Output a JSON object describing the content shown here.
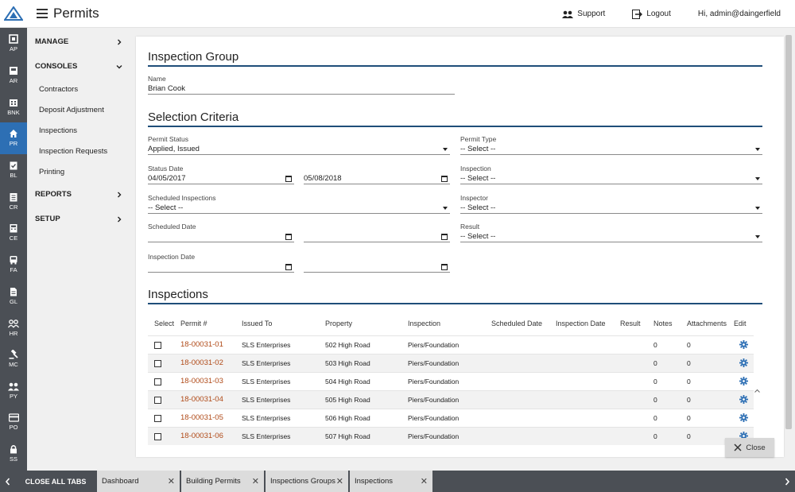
{
  "app": {
    "title": "Permits"
  },
  "header": {
    "support_label": "Support",
    "logout_label": "Logout",
    "greeting": "Hi, admin@daingerfield"
  },
  "rail": [
    {
      "code": "AP",
      "icon": "ap-icon"
    },
    {
      "code": "AR",
      "icon": "ar-icon"
    },
    {
      "code": "BNK",
      "icon": "bank-icon"
    },
    {
      "code": "PR",
      "icon": "home-icon",
      "active": true
    },
    {
      "code": "BL",
      "icon": "clipboard-check-icon"
    },
    {
      "code": "CR",
      "icon": "receipt-icon"
    },
    {
      "code": "CE",
      "icon": "calculator-icon"
    },
    {
      "code": "FA",
      "icon": "bus-icon"
    },
    {
      "code": "GL",
      "icon": "document-icon"
    },
    {
      "code": "HR",
      "icon": "people-icon"
    },
    {
      "code": "MC",
      "icon": "gavel-icon"
    },
    {
      "code": "PY",
      "icon": "group-icon"
    },
    {
      "code": "PO",
      "icon": "credit-card-icon"
    },
    {
      "code": "SS",
      "icon": "lock-icon"
    }
  ],
  "sidenav": {
    "manage": "MANAGE",
    "consoles": "CONSOLES",
    "console_items": [
      "Contractors",
      "Deposit Adjustment",
      "Inspections",
      "Inspection Requests",
      "Printing"
    ],
    "reports": "REPORTS",
    "setup": "SETUP"
  },
  "group": {
    "title": "Inspection Group",
    "name_label": "Name",
    "name_value": "Brian Cook"
  },
  "criteria": {
    "title": "Selection Criteria",
    "permit_status_label": "Permit Status",
    "permit_status_value": "Applied, Issued",
    "permit_type_label": "Permit Type",
    "permit_type_value": "-- Select --",
    "status_date_label": "Status Date",
    "status_date_from": "04/05/2017",
    "status_date_to": "05/08/2018",
    "inspection_label": "Inspection",
    "inspection_value": "-- Select --",
    "scheduled_insp_label": "Scheduled Inspections",
    "scheduled_insp_value": "-- Select --",
    "inspector_label": "Inspector",
    "inspector_value": "-- Select --",
    "scheduled_date_label": "Scheduled Date",
    "result_label": "Result",
    "result_value": "-- Select --",
    "inspection_date_label": "Inspection Date"
  },
  "inspections": {
    "title": "Inspections",
    "columns": [
      "Select",
      "Permit #",
      "Issued To",
      "Property",
      "Inspection",
      "Scheduled Date",
      "Inspection Date",
      "Result",
      "Notes",
      "Attachments",
      "Edit"
    ],
    "rows": [
      {
        "permit": "18-00031-01",
        "issued_to": "SLS Enterprises",
        "property": "502 High Road",
        "inspection": "Piers/Foundation",
        "scheduled": "",
        "inspected": "",
        "result": "",
        "notes": "0",
        "attachments": "0"
      },
      {
        "permit": "18-00031-02",
        "issued_to": "SLS Enterprises",
        "property": "503 High Road",
        "inspection": "Piers/Foundation",
        "scheduled": "",
        "inspected": "",
        "result": "",
        "notes": "0",
        "attachments": "0"
      },
      {
        "permit": "18-00031-03",
        "issued_to": "SLS Enterprises",
        "property": "504 High Road",
        "inspection": "Piers/Foundation",
        "scheduled": "",
        "inspected": "",
        "result": "",
        "notes": "0",
        "attachments": "0"
      },
      {
        "permit": "18-00031-04",
        "issued_to": "SLS Enterprises",
        "property": "505 High Road",
        "inspection": "Piers/Foundation",
        "scheduled": "",
        "inspected": "",
        "result": "",
        "notes": "0",
        "attachments": "0"
      },
      {
        "permit": "18-00031-05",
        "issued_to": "SLS Enterprises",
        "property": "506 High Road",
        "inspection": "Piers/Foundation",
        "scheduled": "",
        "inspected": "",
        "result": "",
        "notes": "0",
        "attachments": "0"
      },
      {
        "permit": "18-00031-06",
        "issued_to": "SLS Enterprises",
        "property": "507 High Road",
        "inspection": "Piers/Foundation",
        "scheduled": "",
        "inspected": "",
        "result": "",
        "notes": "0",
        "attachments": "0"
      }
    ]
  },
  "close_label": "Close",
  "tabs": {
    "close_all": "CLOSE ALL TABS",
    "items": [
      "Dashboard",
      "Building Permits",
      "Inspections Groups",
      "Inspections"
    ]
  },
  "colors": {
    "accent": "#2d6fb4",
    "rule": "#1f4e79",
    "link": "#b04a18",
    "rail": "#4b4f55"
  }
}
